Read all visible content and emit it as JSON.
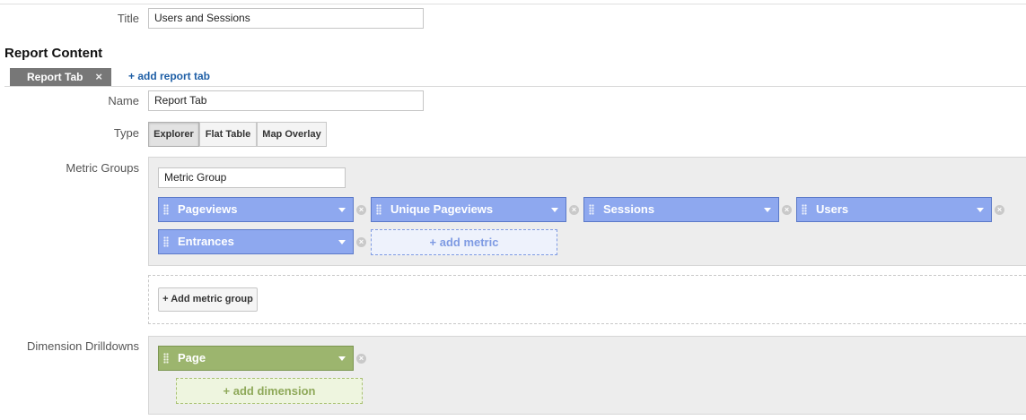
{
  "title_field": {
    "label": "Title",
    "value": "Users and Sessions"
  },
  "report_content": {
    "heading": "Report Content",
    "tabs": [
      {
        "label": "Report Tab",
        "close": "×"
      }
    ],
    "add_tab_label": "+ add report tab"
  },
  "name_field": {
    "label": "Name",
    "value": "Report Tab"
  },
  "type_field": {
    "label": "Type",
    "options": [
      "Explorer",
      "Flat Table",
      "Map Overlay"
    ],
    "selected": "Explorer"
  },
  "metric_groups": {
    "label": "Metric Groups",
    "group_name": "Metric Group",
    "metrics": [
      "Pageviews",
      "Unique Pageviews",
      "Sessions",
      "Users",
      "Entrances"
    ],
    "add_metric_label": "+ add metric",
    "add_group_label": "+ Add metric group",
    "remove_glyph": "×"
  },
  "dimension_drilldowns": {
    "label": "Dimension Drilldowns",
    "dimensions": [
      "Page"
    ],
    "add_dimension_label": "+ add dimension"
  },
  "colors": {
    "metric_chip": "#8ea8ef",
    "dimension_chip": "#9cb56e",
    "link": "#1f5fa6",
    "active_tab": "#777777"
  },
  "icons": {
    "drag_handle": "grip-icon",
    "dropdown": "caret-down-icon",
    "remove": "remove-circle-icon",
    "close_tab": "close-icon"
  }
}
